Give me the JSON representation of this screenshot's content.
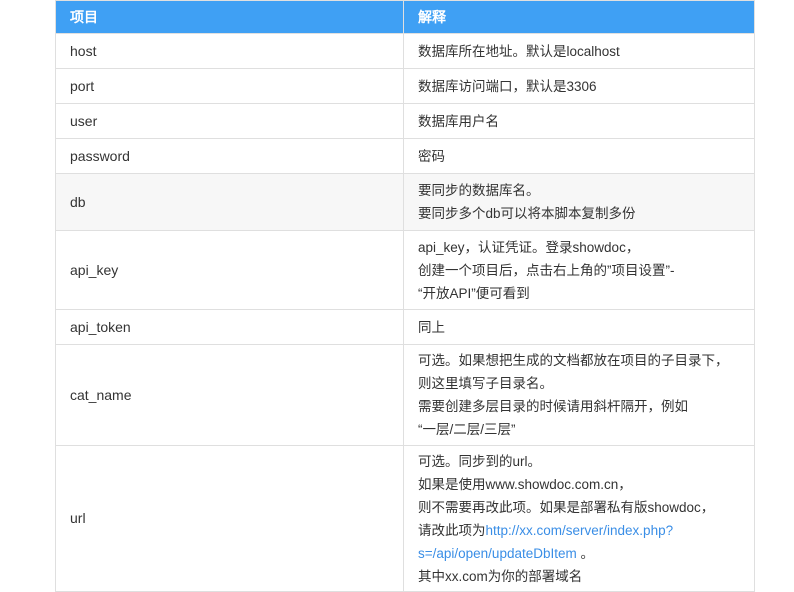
{
  "header": {
    "col1": "项目",
    "col2": "解释"
  },
  "rows": [
    {
      "key": "host",
      "lines": [
        "数据库所在地址。默认是localhost"
      ]
    },
    {
      "key": "port",
      "lines": [
        "数据库访问端口，默认是3306"
      ]
    },
    {
      "key": "user",
      "lines": [
        "数据库用户名"
      ]
    },
    {
      "key": "password",
      "lines": [
        "密码"
      ]
    },
    {
      "key": "db",
      "lines": [
        "要同步的数据库名。",
        "要同步多个db可以将本脚本复制多份"
      ]
    },
    {
      "key": "api_key",
      "lines": [
        "api_key，认证凭证。登录showdoc，",
        "创建一个项目后，点击右上角的”项目设置”-",
        "“开放API”便可看到"
      ]
    },
    {
      "key": "api_token",
      "lines": [
        "同上"
      ]
    },
    {
      "key": "cat_name",
      "lines": [
        "可选。如果想把生成的文档都放在项目的子目录下，",
        "则这里填写子目录名。",
        "需要创建多层目录的时候请用斜杆隔开，例如",
        "“一层/二层/三层”"
      ]
    },
    {
      "key": "url",
      "lines": [
        "可选。同步到的url。",
        "如果是使用www.showdoc.com.cn，",
        "则不需要再改此项。如果是部署私有版showdoc，"
      ],
      "link_prefix": "请改此项为",
      "link_part1": "http://xx.com/server/index.php?",
      "link_part2": "s=/api/open/updateDbItem",
      "link_suffix": " 。",
      "last_line": "其中xx.com为你的部署域名"
    }
  ],
  "colors": {
    "header_bg": "#3fa0f4",
    "link": "#3a8ee6",
    "alt_row_bg": "#f7f7f7"
  }
}
